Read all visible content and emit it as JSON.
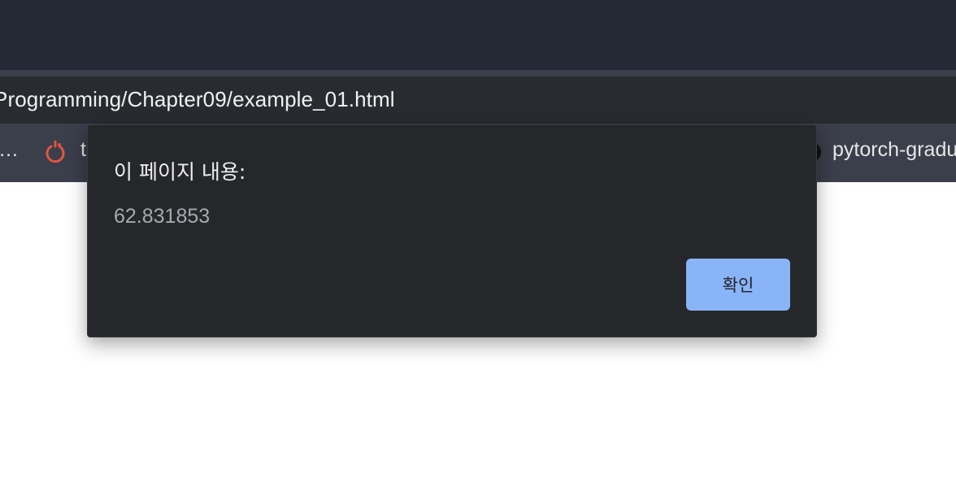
{
  "browser": {
    "address_bar": {
      "url": "Programming/Chapter09/example_01.html"
    },
    "bookmarks": {
      "items": [
        {
          "label": "…",
          "icon": "overflow-icon"
        },
        {
          "label": "t",
          "icon": "pytorch-icon"
        },
        {
          "label": "pytorch-gradu",
          "icon": "circle-icon"
        }
      ]
    }
  },
  "dialog": {
    "title": "이 페이지 내용:",
    "message": "62.831853",
    "ok_label": "확인"
  },
  "colors": {
    "tabstrip": "#252935",
    "toolbar": "#282b30",
    "bookmarks_bar": "#3b3e4b",
    "dialog_bg": "#25272b",
    "ok_button": "#8ab4f8",
    "pytorch_orange": "#e0553f"
  }
}
